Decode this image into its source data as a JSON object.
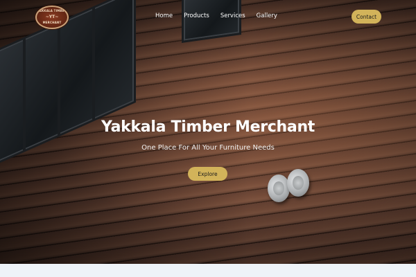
{
  "logo": {
    "line_top": "YAKKALA TIMBER",
    "line_mid": "~YT~",
    "line_bottom": "MERCHANT"
  },
  "nav": {
    "items": [
      {
        "label": "Home"
      },
      {
        "label": "Products"
      },
      {
        "label": "Services"
      },
      {
        "label": "Gallery"
      }
    ],
    "contact_label": "Contact"
  },
  "hero": {
    "title": "Yakkala Timber Merchant",
    "tagline": "One Place For All Your Furniture Needs",
    "cta_label": "Explore"
  },
  "colors": {
    "accent": "#d2b35a",
    "page_background": "#eef3f8",
    "text_on_hero": "#ffffff"
  }
}
